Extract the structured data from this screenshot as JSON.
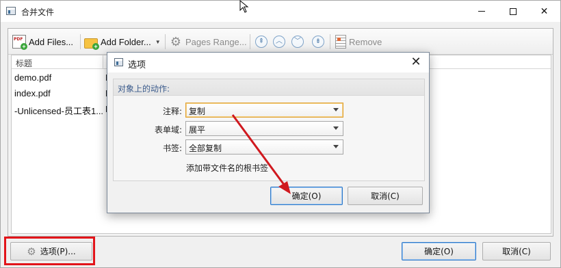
{
  "window": {
    "title": "合并文件",
    "controls": {
      "minimize": "minimize",
      "maximize": "maximize",
      "close": "close"
    }
  },
  "toolbar": {
    "add_files": "Add Files...",
    "add_folder": "Add Folder...",
    "pages_range": "Pages Range...",
    "remove": "Remove",
    "move_buttons": [
      "move-top-icon",
      "move-up-icon",
      "move-down-icon",
      "move-bottom-icon"
    ]
  },
  "list": {
    "column_title": "标题",
    "rows": [
      {
        "name": "demo.pdf",
        "b": "E"
      },
      {
        "name": "index.pdf",
        "b": "E"
      },
      {
        "name": "-Unlicensed-员工表1...",
        "b": "E"
      }
    ]
  },
  "bottom": {
    "options_label": "选项(P)...",
    "ok_label": "确定(O)",
    "cancel_label": "取消(C)"
  },
  "dialog": {
    "title": "选项",
    "group_title": "对象上的动作:",
    "fields": [
      {
        "label": "注释:",
        "value": "复制"
      },
      {
        "label": "表单域:",
        "value": "展平"
      },
      {
        "label": "书签:",
        "value": "全部复制"
      }
    ],
    "note": "添加带文件名的根书签",
    "ok_label": "确定(O)",
    "cancel_label": "取消(C)"
  },
  "colors": {
    "highlight_box": "#e2141a",
    "arrow": "#d0191f",
    "default_button_border": "#2f79c9",
    "focus_border": "#e0a030"
  }
}
